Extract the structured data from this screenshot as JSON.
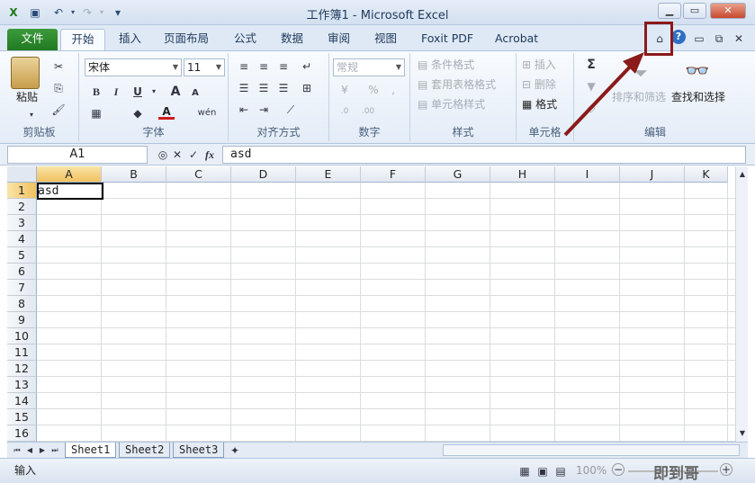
{
  "window": {
    "title": "工作簿1 - Microsoft Excel",
    "min": "▭",
    "max": "▭",
    "close": "✕"
  },
  "tabs": [
    "文件",
    "开始",
    "插入",
    "页面布局",
    "公式",
    "数据",
    "审阅",
    "视图",
    "Foxit PDF",
    "Acrobat"
  ],
  "ribbon": {
    "clipboard": {
      "label": "剪贴板",
      "paste": "粘贴"
    },
    "font": {
      "label": "字体",
      "name": "宋体",
      "size": "11",
      "bold": "B",
      "italic": "I",
      "underline": "U",
      "grow": "A",
      "shrink": "A",
      "color": "A",
      "phonetic": "wén"
    },
    "alignment": {
      "label": "对齐方式"
    },
    "number": {
      "label": "数字",
      "format": "常规",
      "percent": "%",
      "comma": ","
    },
    "styles": {
      "label": "样式",
      "conditional": "条件格式",
      "table": "套用表格格式",
      "cell": "单元格样式"
    },
    "cells": {
      "label": "单元格",
      "insert": "插入",
      "delete": "删除",
      "format": "格式"
    },
    "editing": {
      "label": "编辑",
      "sum": "Σ",
      "sort": "排序和筛选",
      "find": "查找和选择"
    }
  },
  "formula_bar": {
    "name_box": "A1",
    "fx": "fx",
    "value": "asd"
  },
  "grid": {
    "columns": [
      "A",
      "B",
      "C",
      "D",
      "E",
      "F",
      "G",
      "H",
      "I",
      "J",
      "K"
    ],
    "rows": [
      "1",
      "2",
      "3",
      "4",
      "5",
      "6",
      "7",
      "8",
      "9",
      "10",
      "11",
      "12",
      "13",
      "14",
      "15",
      "16"
    ],
    "a1_value": "asd"
  },
  "sheets": [
    "Sheet1",
    "Sheet2",
    "Sheet3"
  ],
  "status": {
    "mode": "输入",
    "zoom": "100%"
  },
  "watermark": "即到哥",
  "colors": {
    "file_tab": "#2e8b2e",
    "highlight": "#8b1a1a",
    "selection": "#000000"
  }
}
